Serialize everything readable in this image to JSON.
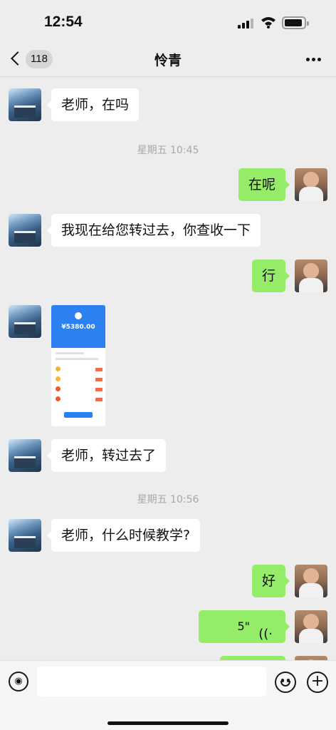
{
  "status_bar": {
    "time": "12:54",
    "icons": [
      "cellular-signal-icon",
      "wifi-icon",
      "battery-icon"
    ]
  },
  "nav": {
    "back_icon": "chevron-left-icon",
    "unread_count": "118",
    "title": "怜青",
    "more_icon": "more-dots-icon"
  },
  "messages": [
    {
      "side": "left",
      "type": "text",
      "text": "老师，在吗"
    },
    {
      "type": "timestamp",
      "text": "星期五 10:45"
    },
    {
      "side": "right",
      "type": "text",
      "text": "在呢"
    },
    {
      "side": "left",
      "type": "text",
      "text": "我现在给您转过去，你查收一下"
    },
    {
      "side": "right",
      "type": "text",
      "text": "行"
    },
    {
      "side": "left",
      "type": "image",
      "amount": "¥5380.00"
    },
    {
      "side": "left",
      "type": "text",
      "text": "老师，转过去了"
    },
    {
      "type": "timestamp",
      "text": "星期五 10:56"
    },
    {
      "side": "left",
      "type": "text",
      "text": "老师，什么时候教学?"
    },
    {
      "side": "right",
      "type": "text",
      "text": "好"
    },
    {
      "side": "right",
      "type": "voice",
      "duration": "5\"",
      "icon": "voice-wave-icon"
    }
  ],
  "input_bar": {
    "voice_icon": "voice-mode-icon",
    "voice_glyph": "◉",
    "placeholder": "",
    "emoji_icon": "emoji-icon",
    "plus_icon": "plus-icon",
    "plus_glyph": "+"
  },
  "colors": {
    "background": "#ededed",
    "own_bubble": "#95ec69",
    "other_bubble": "#ffffff",
    "timestamp_text": "#a8a8a8",
    "transfer_blue": "#2b80f2"
  }
}
